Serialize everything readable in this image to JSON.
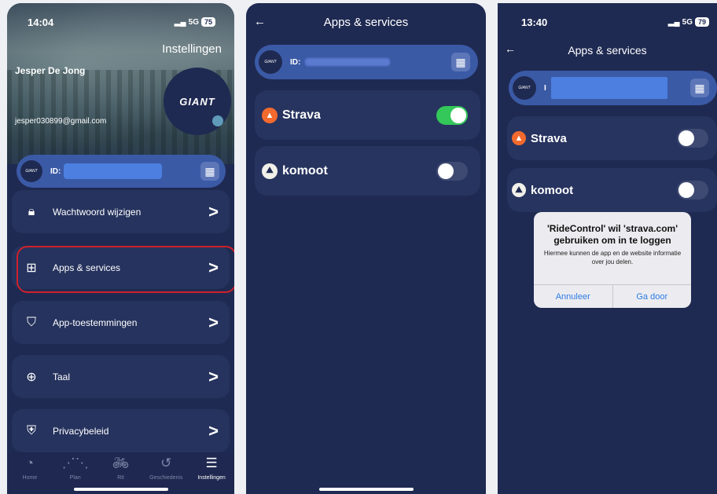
{
  "panel1": {
    "status": {
      "time": "14:04",
      "network": "5G",
      "battery": "75"
    },
    "title": "Instellingen",
    "user_name": "Jesper De Jong",
    "email": "jesper030899@gmail.com",
    "logo_text": "GIANT",
    "id_label": "ID:",
    "menu": [
      {
        "label": "Wachtwoord wijzigen",
        "icon": "lock-icon"
      },
      {
        "label": "Apps & services",
        "icon": "grid-icon"
      },
      {
        "label": "App-toestemmingen",
        "icon": "shield-check-icon"
      },
      {
        "label": "Taal",
        "icon": "globe-icon"
      },
      {
        "label": "Privacybeleid",
        "icon": "shield-user-icon"
      }
    ],
    "tabs": [
      {
        "label": "Home",
        "icon": "gauge-icon"
      },
      {
        "label": "Plan",
        "icon": "road-icon"
      },
      {
        "label": "Rit",
        "icon": "bike-icon"
      },
      {
        "label": "Geschiedenis",
        "icon": "history-icon"
      },
      {
        "label": "Instellingen",
        "icon": "sliders-icon"
      }
    ]
  },
  "panel2": {
    "title": "Apps & services",
    "id_label": "ID:",
    "services": [
      {
        "name": "Strava",
        "enabled": true
      },
      {
        "name": "komoot",
        "enabled": false
      }
    ]
  },
  "panel3": {
    "status": {
      "time": "13:40",
      "network": "5G",
      "battery": "79"
    },
    "title": "Apps & services",
    "id_label": "I",
    "services": [
      {
        "name": "Strava",
        "enabled": false
      },
      {
        "name": "komoot",
        "enabled": false
      }
    ],
    "alert": {
      "title": "'RideControl' wil 'strava.com' gebruiken om in te loggen",
      "message": "Hiermee kunnen de app en de website informatie over jou delen.",
      "cancel": "Annuleer",
      "confirm": "Ga door"
    }
  },
  "colors": {
    "background": "#1f2a52",
    "card": "#26335e",
    "accent": "#3b5aa6",
    "strava": "#f26a2e",
    "toggle_on": "#34c759",
    "highlight": "#d0202a"
  }
}
